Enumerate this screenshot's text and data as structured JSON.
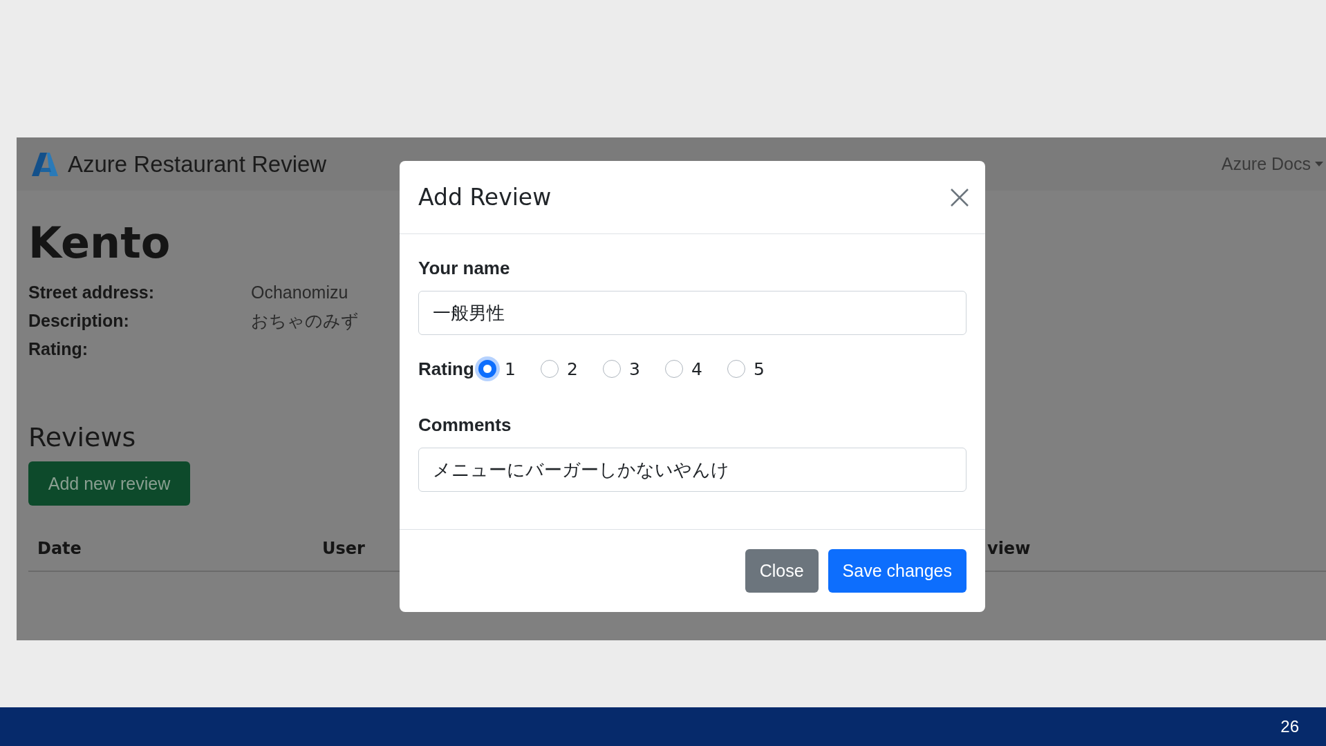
{
  "app": {
    "brand": "Azure Restaurant Review",
    "nav_link": "Azure Docs",
    "restaurant": {
      "name": "Kento",
      "details": [
        {
          "label": "Street address:",
          "value": "Ochanomizu"
        },
        {
          "label": "Description:",
          "value": "おちゃのみず"
        },
        {
          "label": "Rating:"
        }
      ]
    },
    "reviews": {
      "title": "Reviews",
      "add_button": "Add new review",
      "columns": [
        "Date",
        "User",
        "view"
      ]
    }
  },
  "modal": {
    "title": "Add Review",
    "name_field": {
      "label": "Your name",
      "value": "一般男性"
    },
    "rating": {
      "label": "Rating",
      "options": [
        {
          "label": "1",
          "selected": true
        },
        {
          "label": "2",
          "selected": false
        },
        {
          "label": "3",
          "selected": false
        },
        {
          "label": "4",
          "selected": false
        },
        {
          "label": "5",
          "selected": false
        }
      ]
    },
    "comments_field": {
      "label": "Comments",
      "value": "メニューにバーガーしかないやんけ"
    },
    "buttons": [
      {
        "label": "Close",
        "kind": "secondary"
      },
      {
        "label": "Save changes",
        "kind": "primary"
      }
    ]
  },
  "slide": {
    "page_number": "26"
  }
}
